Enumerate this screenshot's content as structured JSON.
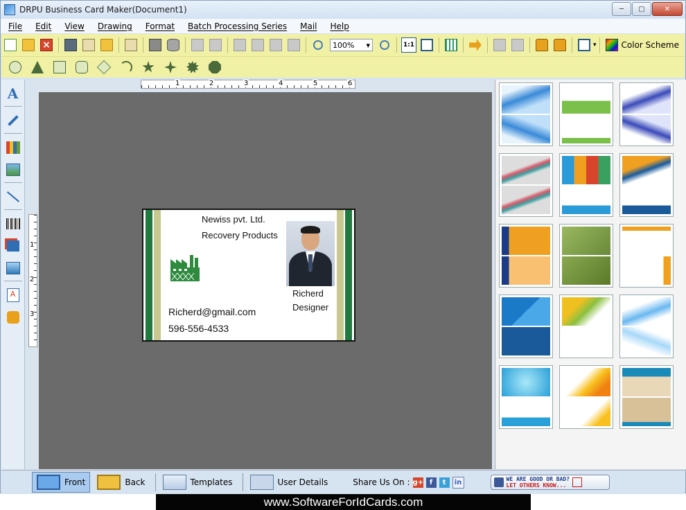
{
  "window": {
    "title": "DRPU Business Card Maker(Document1)"
  },
  "menu": [
    "File",
    "Edit",
    "View",
    "Drawing",
    "Format",
    "Batch Processing Series",
    "Mail",
    "Help"
  ],
  "toolbar": {
    "zoom": "100%",
    "fit_label": "1:1",
    "color_scheme_label": "Color Scheme"
  },
  "ruler": {
    "h": [
      "1",
      "2",
      "3",
      "4",
      "5",
      "6"
    ],
    "v": [
      "1",
      "2",
      "3"
    ]
  },
  "card": {
    "company": "Newiss pvt. Ltd.",
    "product": "Recovery Products",
    "email": "Richerd@gmail.com",
    "phone": "596-556-4533",
    "name": "Richerd",
    "title": "Designer"
  },
  "bottom": {
    "front": "Front",
    "back": "Back",
    "templates": "Templates",
    "user_details": "User Details",
    "share_label": "Share Us On :",
    "share_icons": [
      "g+",
      "f",
      "t",
      "in"
    ],
    "feedback_line1": "WE ARE GOOD OR BAD?",
    "feedback_line2": "LET OTHERS KNOW..."
  },
  "banner": {
    "url": "www.SoftwareForIdCards.com"
  },
  "templates": [
    {
      "top": "linear-gradient(160deg,#e8f4fc 20%,#3a8ad8 45%,#bfe0f8 70%)",
      "bottom": "linear-gradient(20deg,#e8f4fc 20%,#3a8ad8 45%,#bfe0f8 70%)"
    },
    {
      "top": "linear-gradient(#fff 55%,#7ac04a 55%)",
      "bottom": "linear-gradient(#fff 80%,#7ac04a 80%)"
    },
    {
      "top": "linear-gradient(160deg,#fff 30%,#3a4ab8 50%,#dfe4fa 70%)",
      "bottom": "linear-gradient(20deg,#fff 30%,#3a4ab8 50%,#dfe4fa 70%)"
    },
    {
      "top": "linear-gradient(160deg,#ddd 40%,#d85a6a 48%,#3aa0a0 56%,#ddd 64%)",
      "bottom": "linear-gradient(160deg,#ddd 40%,#d85a6a 48%,#3aa0a0 56%,#ddd 64%)"
    },
    {
      "top": "linear-gradient(90deg,#2a9ad8 0 25%,#f0a020 25% 50%,#d8452c 50% 75%,#3aa060 75%)",
      "bottom": "linear-gradient(#fff 70%,#2a9ad8 70%)"
    },
    {
      "top": "linear-gradient(160deg,#f0a020 35%,#1a5a9a 50%,#fff 65%)",
      "bottom": "linear-gradient(#fff 70%,#1a5a9a 70%)"
    },
    {
      "top": "linear-gradient(90deg,#1a3a8a 0 15%,#f0a020 15%)",
      "bottom": "linear-gradient(90deg,#1a3a8a 0 15%,#f8c070 15%)"
    },
    {
      "top": "linear-gradient(135deg,#9ab860,#6a8a3a)",
      "bottom": "linear-gradient(135deg,#8aa850,#5a7a2a)"
    },
    {
      "top": "linear-gradient(#f0a020 0 15%,#fff 15%)",
      "bottom": "linear-gradient(90deg,#fff 85%,#f0a020 85%)"
    },
    {
      "top": "linear-gradient(135deg,#1a7ac8 50%,#4aa8e8 50%)",
      "bottom": "linear-gradient(#1a5a9a,#1a5a9a)"
    },
    {
      "top": "linear-gradient(135deg,#f0c020 30%,#8ac040 50%,#fff 70%)",
      "bottom": "linear-gradient(#fff,#fff)"
    },
    {
      "top": "linear-gradient(160deg,#fff 30%,#6ab8f0 55%,#fff 75%)",
      "bottom": "linear-gradient(20deg,#fff 30%,#a8d8f8 55%,#fff 75%)"
    },
    {
      "top": "radial-gradient(circle,#a8e8f8,#2aa0d8)",
      "bottom": "linear-gradient(#fff 70%,#2aa0d8 70%)"
    },
    {
      "top": "linear-gradient(135deg,#fff 40%,#f8c020 60%,#f08010 80%)",
      "bottom": "linear-gradient(135deg,#fff 60%,#f8c020 80%)"
    },
    {
      "top": "linear-gradient(#1a8ab8 0 30%,#e8d8b8 30%)",
      "bottom": "linear-gradient(#d8c098 85%,#1a8ab8 85%)"
    }
  ]
}
